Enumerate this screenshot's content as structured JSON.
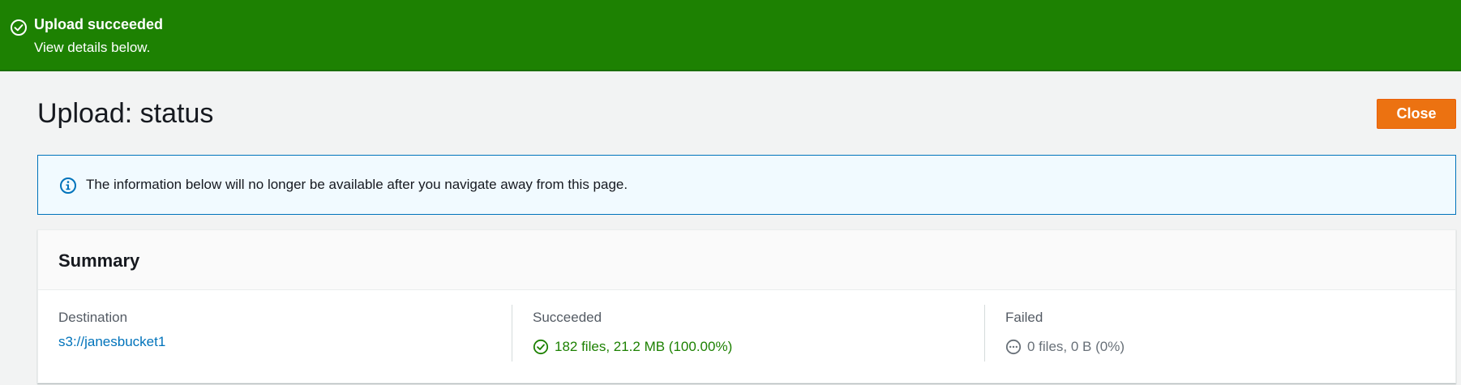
{
  "flash": {
    "icon": "check-circle-icon",
    "title": "Upload succeeded",
    "message": "View details below.",
    "color": "#1d8102"
  },
  "page": {
    "title": "Upload: status",
    "close_label": "Close",
    "close_color": "#ec7211"
  },
  "info": {
    "icon": "info-circle-icon",
    "text": "The information below will no longer be available after you navigate away from this page."
  },
  "summary": {
    "title": "Summary",
    "destination": {
      "label": "Destination",
      "value": "s3://janesbucket1"
    },
    "succeeded": {
      "label": "Succeeded",
      "icon": "check-circle-icon",
      "value": "182 files, 21.2 MB (100.00%)"
    },
    "failed": {
      "label": "Failed",
      "icon": "ellipsis-circle-icon",
      "value": "0 files, 0 B (0%)"
    }
  }
}
